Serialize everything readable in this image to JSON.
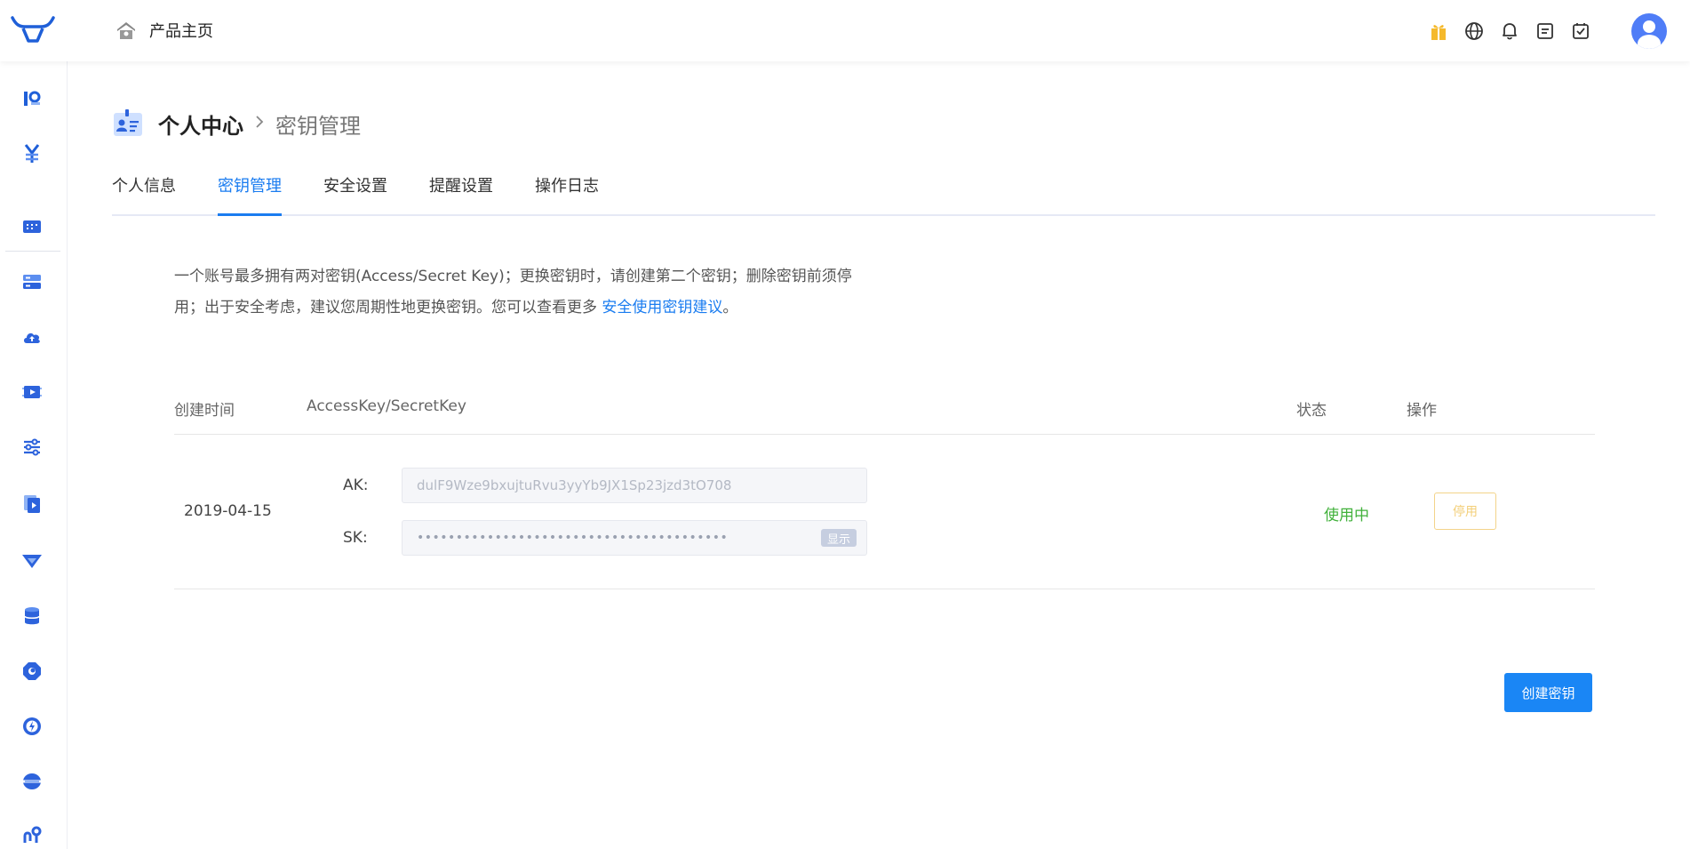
{
  "header": {
    "home_label": "产品主页",
    "right_icons": [
      "gift-icon",
      "globe-icon",
      "bell-icon",
      "document-icon",
      "todo-check-icon"
    ]
  },
  "sidebar": {
    "items": [
      "key-profile-icon",
      "yen-icon",
      "dashboard-icon",
      "server-icon",
      "cloud-upload-icon",
      "media-icon",
      "sliders-icon",
      "video-file-icon",
      "cdn-icon",
      "database-icon",
      "security-icon",
      "lightning-icon",
      "network-icon",
      "route-icon"
    ]
  },
  "breadcrumb": {
    "title": "个人中心",
    "separator": ">",
    "current": "密钥管理"
  },
  "tabs": [
    {
      "label": "个人信息",
      "active": false
    },
    {
      "label": "密钥管理",
      "active": true
    },
    {
      "label": "安全设置",
      "active": false
    },
    {
      "label": "提醒设置",
      "active": false
    },
    {
      "label": "操作日志",
      "active": false
    }
  ],
  "description": {
    "line1": "一个账号最多拥有两对密钥(Access/Secret Key)；更换密钥时，请创建第二个密钥；删除密钥前须停",
    "line2": "用；出于安全考虑，建议您周期性地更换密钥。您可以查看更多 ",
    "link": "安全使用密钥建议",
    "end": "。"
  },
  "table": {
    "headers": {
      "created": "创建时间",
      "keys": "AccessKey/SecretKey",
      "status": "状态",
      "action": "操作"
    },
    "rows": [
      {
        "date": "2019-04-15",
        "ak_label": "AK:",
        "ak_value": "dulF9Wze9bxujtuRvu3yyYb9JX1Sp23jzd3tO708",
        "sk_label": "SK:",
        "sk_value": "••••••••••••••••••••••••••••••••••••••••",
        "show_label": "显示",
        "status": "使用中",
        "action": "停用"
      }
    ]
  },
  "create_button": "创建密钥",
  "colors": {
    "primary": "#1a86f5",
    "status_active": "#41b13b",
    "warning_border": "#f3d38a"
  }
}
